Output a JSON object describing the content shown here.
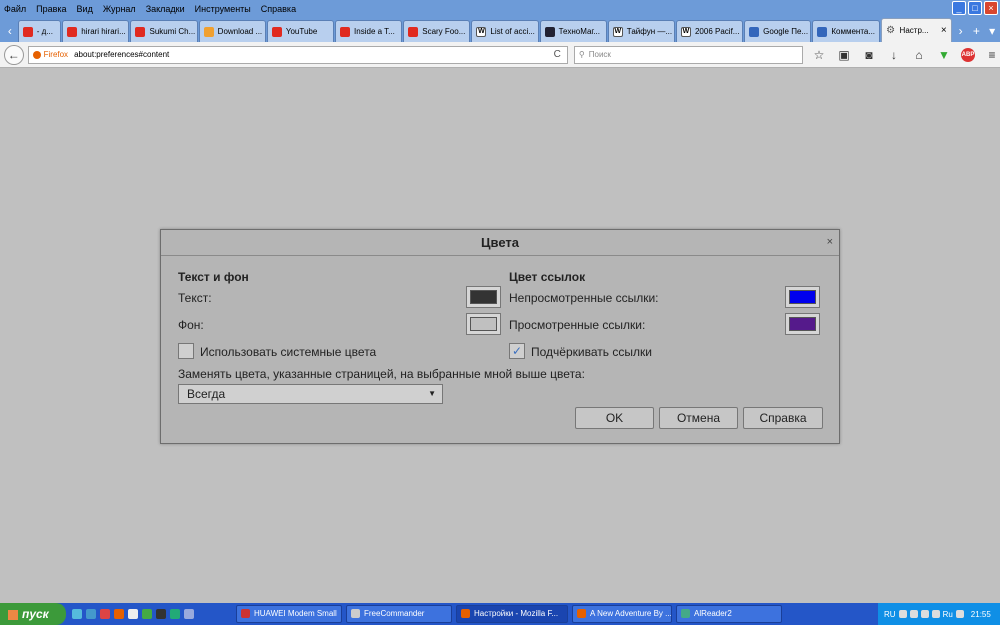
{
  "menubar": [
    "Файл",
    "Правка",
    "Вид",
    "Журнал",
    "Закладки",
    "Инструменты",
    "Справка"
  ],
  "window_controls": [
    "_",
    "□",
    "×"
  ],
  "tabs": [
    {
      "label": "- д...",
      "icon": "youtube-icon",
      "fav": "yt",
      "fav_text": "",
      "width": 44
    },
    {
      "label": "hirari hirari...",
      "icon": "youtube-icon",
      "fav": "yt",
      "fav_text": "",
      "width": 68
    },
    {
      "label": "Sukumi Ch...",
      "icon": "youtube-icon",
      "fav": "yt",
      "fav_text": "",
      "width": 68
    },
    {
      "label": "Download ...",
      "icon": "download-icon",
      "fav": "dl",
      "fav_text": "",
      "width": 68
    },
    {
      "label": "YouTube",
      "icon": "youtube-icon",
      "fav": "yt",
      "fav_text": "",
      "width": 68
    },
    {
      "label": "Inside a T...",
      "icon": "youtube-icon",
      "fav": "yt",
      "fav_text": "",
      "width": 68
    },
    {
      "label": "Scary Foo...",
      "icon": "youtube-icon",
      "fav": "yt",
      "fav_text": "",
      "width": 68
    },
    {
      "label": "List of acci...",
      "icon": "wikipedia-icon",
      "fav": "w",
      "fav_text": "W",
      "width": 68
    },
    {
      "label": "ТехноМаг...",
      "icon": "pen-icon",
      "fav": "pen",
      "fav_text": "",
      "width": 68
    },
    {
      "label": "Тайфун —...",
      "icon": "wikipedia-icon",
      "fav": "w",
      "fav_text": "W",
      "width": 68
    },
    {
      "label": "2006 Pacif...",
      "icon": "wikipedia-icon",
      "fav": "w",
      "fav_text": "W",
      "width": 68
    },
    {
      "label": "Google Пе...",
      "icon": "document-icon",
      "fav": "doc",
      "fav_text": "",
      "width": 68
    },
    {
      "label": "Коммента...",
      "icon": "document-icon",
      "fav": "doc",
      "fav_text": "",
      "width": 68
    },
    {
      "label": "Настр...",
      "icon": "gear-icon",
      "fav": "gear",
      "fav_text": "⚙",
      "width": 72,
      "active": true
    }
  ],
  "tab_controls": {
    "scroll_right": "›",
    "new_tab": "+",
    "list": "▾"
  },
  "navbar": {
    "back": "←",
    "identity": "Firefox",
    "url": "about:preferences#content",
    "reload": "C",
    "search_placeholder": "Поиск",
    "search_icon": "⚲"
  },
  "nav_icons": [
    {
      "name": "bookmark-star-icon",
      "glyph": "☆"
    },
    {
      "name": "clipboard-icon",
      "glyph": "▣"
    },
    {
      "name": "pocket-icon",
      "glyph": "◙"
    },
    {
      "name": "downloads-icon",
      "glyph": "↓"
    },
    {
      "name": "home-icon",
      "glyph": "⌂"
    },
    {
      "name": "download-helper-icon",
      "glyph": "▼"
    },
    {
      "name": "adblock-icon",
      "glyph": "ABP"
    },
    {
      "name": "menu-icon",
      "glyph": "≡"
    }
  ],
  "dialog": {
    "title": "Цвета",
    "close": "×",
    "text_bg": {
      "heading": "Текст и фон",
      "text_label": "Текст:",
      "bg_label": "Фон:",
      "text_color": "#333333",
      "bg_color": "#c0c0c0"
    },
    "links": {
      "heading": "Цвет ссылок",
      "unvisited_label": "Непросмотренные ссылки:",
      "visited_label": "Просмотренные ссылки:",
      "unvisited_color": "#0000ee",
      "visited_color": "#551a8b"
    },
    "use_system_colors": {
      "label": "Использовать системные цвета",
      "checked": false
    },
    "underline_links": {
      "label": "Подчёркивать ссылки",
      "checked": true
    },
    "override_label": "Заменять цвета, указанные страницей, на выбранные мной выше цвета:",
    "override_value": "Всегда",
    "buttons": {
      "ok": "OK",
      "cancel": "Отмена",
      "help": "Справка"
    }
  },
  "taskbar": {
    "start": "пуск",
    "items": [
      {
        "label": "HUAWEI Modem Small",
        "color": "#c33",
        "width": 106
      },
      {
        "label": "FreeCommander",
        "color": "#ccc",
        "width": 106
      },
      {
        "label": "Настройки - Mozilla F...",
        "color": "#e66000",
        "width": 112,
        "active": true
      },
      {
        "label": "A New Adventure By ...",
        "color": "#e66000",
        "width": 100
      },
      {
        "label": "AlReader2",
        "color": "#4a8",
        "width": 106
      }
    ],
    "lang": "RU",
    "lang2": "Ru",
    "clock": "21:55"
  }
}
